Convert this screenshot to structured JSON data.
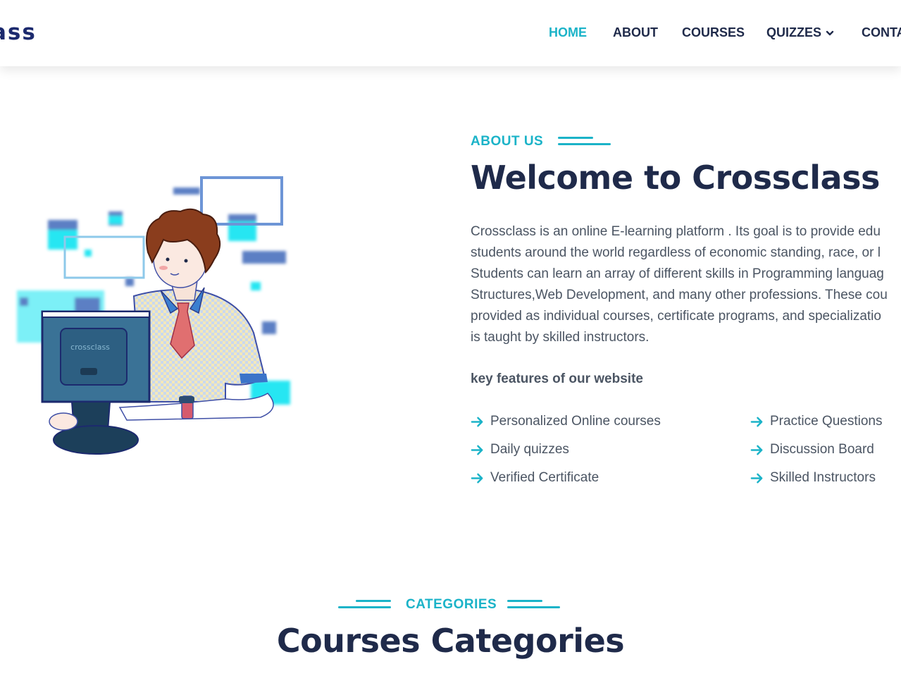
{
  "header": {
    "logo_text": "ass",
    "nav": [
      {
        "label": "HOME",
        "active": true
      },
      {
        "label": "ABOUT"
      },
      {
        "label": "COURSES"
      },
      {
        "label": "QUIZZES"
      },
      {
        "label": "CONTA"
      }
    ]
  },
  "about": {
    "eyebrow": "ABOUT US",
    "heading": "Welcome to Crossclass",
    "paragraph_lines": [
      "Crossclass is an online E-learning platform . Its goal is to provide edu",
      "students around the world regardless of economic standing, race, or l",
      "Students can learn an array of different skills in Programming languag",
      "Structures,Web Development, and many other professions. These cou",
      "provided as individual courses, certificate programs, and specializatio",
      "is taught by skilled instructors."
    ],
    "features_heading": "key features of our website",
    "features_left": [
      "Personalized Online courses",
      "Daily quizzes",
      "Verified Certificate"
    ],
    "features_right": [
      "Practice Questions",
      "Discussion Board",
      "Skilled Instructors"
    ],
    "illustration_caption": "crossclass"
  },
  "categories": {
    "eyebrow": "CATEGORIES",
    "heading": "Courses Categories"
  },
  "colors": {
    "accent": "#1bb3c8",
    "heading": "#1f2a4a",
    "body_text": "#4b5563",
    "logo": "#1c2a6e"
  },
  "icons": {
    "feature_bullet": "arrow-right-icon",
    "dropdown": "chevron-down-icon"
  }
}
